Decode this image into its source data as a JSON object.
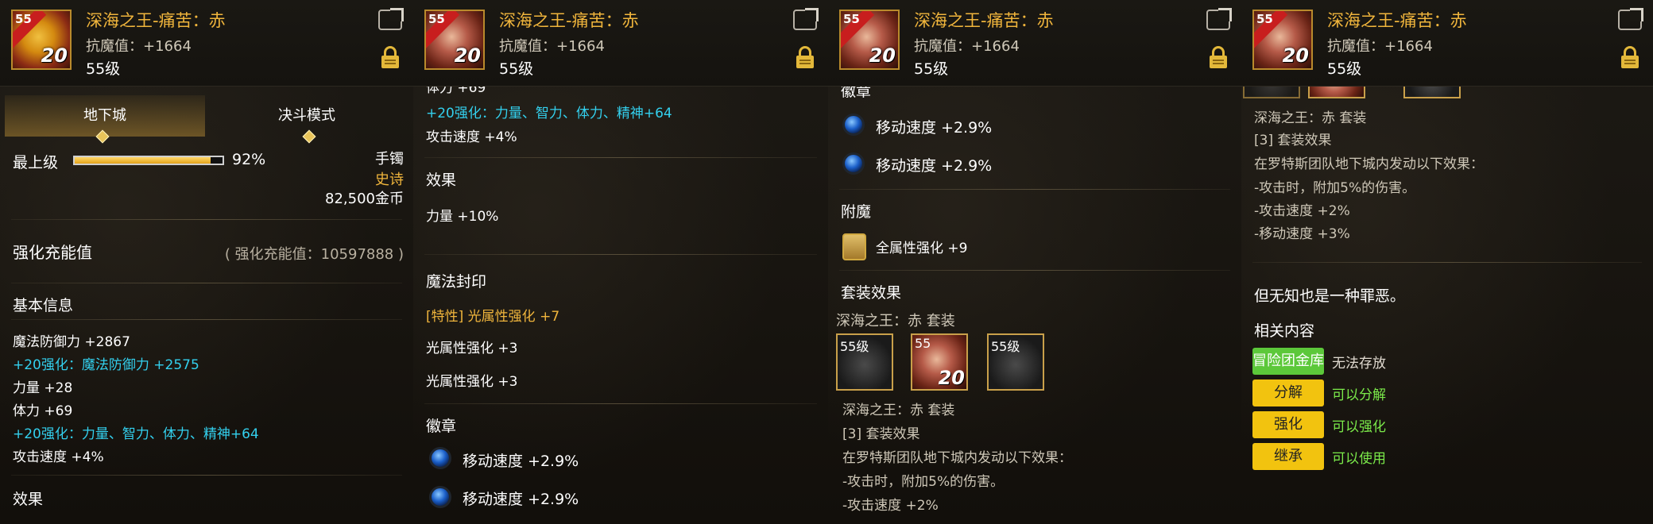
{
  "item": {
    "title": "深海之王-痛苦：赤",
    "resist": "抗魔值：+1664",
    "level": "55级",
    "icon_level": "55",
    "icon_plus": "20",
    "icon_ribbon": "锁定中"
  },
  "panel1": {
    "tab_dungeon": "地下城",
    "tab_duel": "决斗模式",
    "grade_label": "最上级",
    "grade_percent_text": "92%",
    "grade_fraction": 0.92,
    "slot": "手镯",
    "rarity": "史诗",
    "price": "82,500金币",
    "charge_label": "强化充能值",
    "charge_value": "( 强化充能值：10597888 )",
    "basic_info": "基本信息",
    "stats": [
      {
        "text": "魔法防御力 +2867",
        "color": "white"
      },
      {
        "text": "+20强化：魔法防御力 +2575",
        "color": "cyan"
      },
      {
        "text": "力量 +28",
        "color": "white"
      },
      {
        "text": "体力 +69",
        "color": "white"
      },
      {
        "text": "+20强化：力量、智力、体力、精神+64",
        "color": "cyan"
      },
      {
        "text": "攻击速度 +4%",
        "color": "white"
      }
    ],
    "effect_header": "效果"
  },
  "panel2": {
    "top_partial": "体力 +69",
    "enhance_line": "+20强化：力量、智力、体力、精神+64",
    "attack_speed": "攻击速度 +4%",
    "effect_header": "效果",
    "effect_line": "力量 +10%",
    "seal_header": "魔法封印",
    "seal_trait": "[特性] 光属性强化 +7",
    "seal_lines": [
      "光属性强化 +3",
      "光属性强化 +3"
    ],
    "emblem_header": "徽章",
    "emblem_lines": [
      "移动速度 +2.9%",
      "移动速度 +2.9%"
    ]
  },
  "panel3": {
    "emblem_header": "徽章",
    "emblem_lines": [
      "移动速度 +2.9%",
      "移动速度 +2.9%"
    ],
    "enchant_header": "附魔",
    "enchant_line": "全属性强化 +9",
    "set_header": "套装效果",
    "set_name": "深海之王：赤 套装",
    "set_slots": [
      {
        "level": "55级",
        "plus": ""
      },
      {
        "level": "55",
        "plus": "20"
      },
      {
        "level": "55级",
        "plus": ""
      }
    ],
    "set_name2": "深海之王：赤 套装",
    "set_effect": "[3] 套装效果",
    "set_desc": "在罗特斯团队地下城内发动以下效果：",
    "set_lines": [
      "-攻击时，附加5%的伤害。",
      "-攻击速度 +2%"
    ]
  },
  "panel4": {
    "set_name": "深海之王：赤 套装",
    "set_effect": "[3] 套装效果",
    "set_desc": "在罗特斯团队地下城内发动以下效果：",
    "set_lines": [
      "-攻击时，附加5%的伤害。",
      "-攻击速度 +2%",
      "-移动速度 +3%"
    ],
    "flavor": "但无知也是一种罪恶。",
    "related_header": "相关内容",
    "actions": [
      {
        "button": "冒险团金库",
        "status": "无法存放",
        "button_color": "green",
        "status_color": "grey"
      },
      {
        "button": "分解",
        "status": "可以分解",
        "button_color": "yellow",
        "status_color": "green"
      },
      {
        "button": "强化",
        "status": "可以强化",
        "button_color": "yellow",
        "status_color": "green"
      },
      {
        "button": "继承",
        "status": "可以使用",
        "button_color": "yellow",
        "status_color": "green"
      }
    ]
  }
}
